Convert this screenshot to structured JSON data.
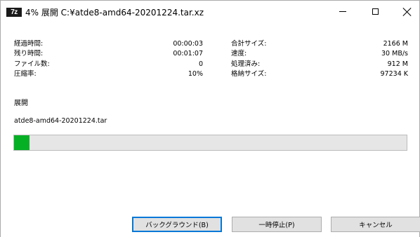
{
  "window": {
    "icon_label": "7z",
    "title": "4% 展開 C:¥atde8-amd64-20201224.tar.xz"
  },
  "icons": {
    "app": "7zip-app-icon",
    "minimize": "minimize-icon",
    "maximize": "maximize-icon",
    "close": "close-icon"
  },
  "stats": {
    "left": [
      {
        "label": "経過時間:",
        "value": "00:00:03"
      },
      {
        "label": "残り時間:",
        "value": "00:01:07"
      },
      {
        "label": "ファイル数:",
        "value": "0"
      },
      {
        "label": "圧縮率:",
        "value": "10%"
      }
    ],
    "right": [
      {
        "label": "合計サイズ:",
        "value": "2166 M"
      },
      {
        "label": "速度:",
        "value": "30 MB/s"
      },
      {
        "label": "処理済み:",
        "value": "912 M"
      },
      {
        "label": "格納サイズ:",
        "value": "97234 K"
      }
    ]
  },
  "operation": {
    "label": "展開",
    "current_file": "atde8-amd64-20201224.tar"
  },
  "progress": {
    "percent": 4,
    "fill_color": "#06b025"
  },
  "buttons": {
    "background": "バックグラウンド(B)",
    "pause": "一時停止(P)",
    "cancel": "キャンセル"
  }
}
